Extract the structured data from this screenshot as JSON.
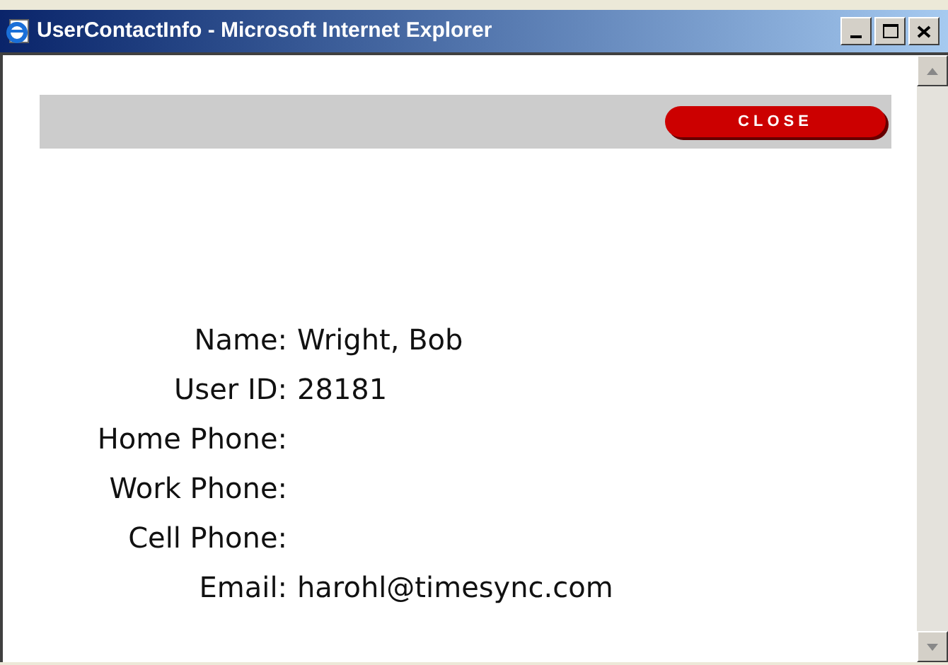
{
  "window": {
    "title": "UserContactInfo - Microsoft Internet Explorer"
  },
  "close_button": {
    "label": "CLOSE"
  },
  "fields": [
    {
      "label": "Name:",
      "value": "Wright, Bob"
    },
    {
      "label": "User ID:",
      "value": "28181"
    },
    {
      "label": "Home Phone:"
    },
    {
      "label": "Work Phone:"
    },
    {
      "label": "Cell Phone:"
    },
    {
      "label": "Email:",
      "value": "harohl@timesync.com"
    }
  ]
}
